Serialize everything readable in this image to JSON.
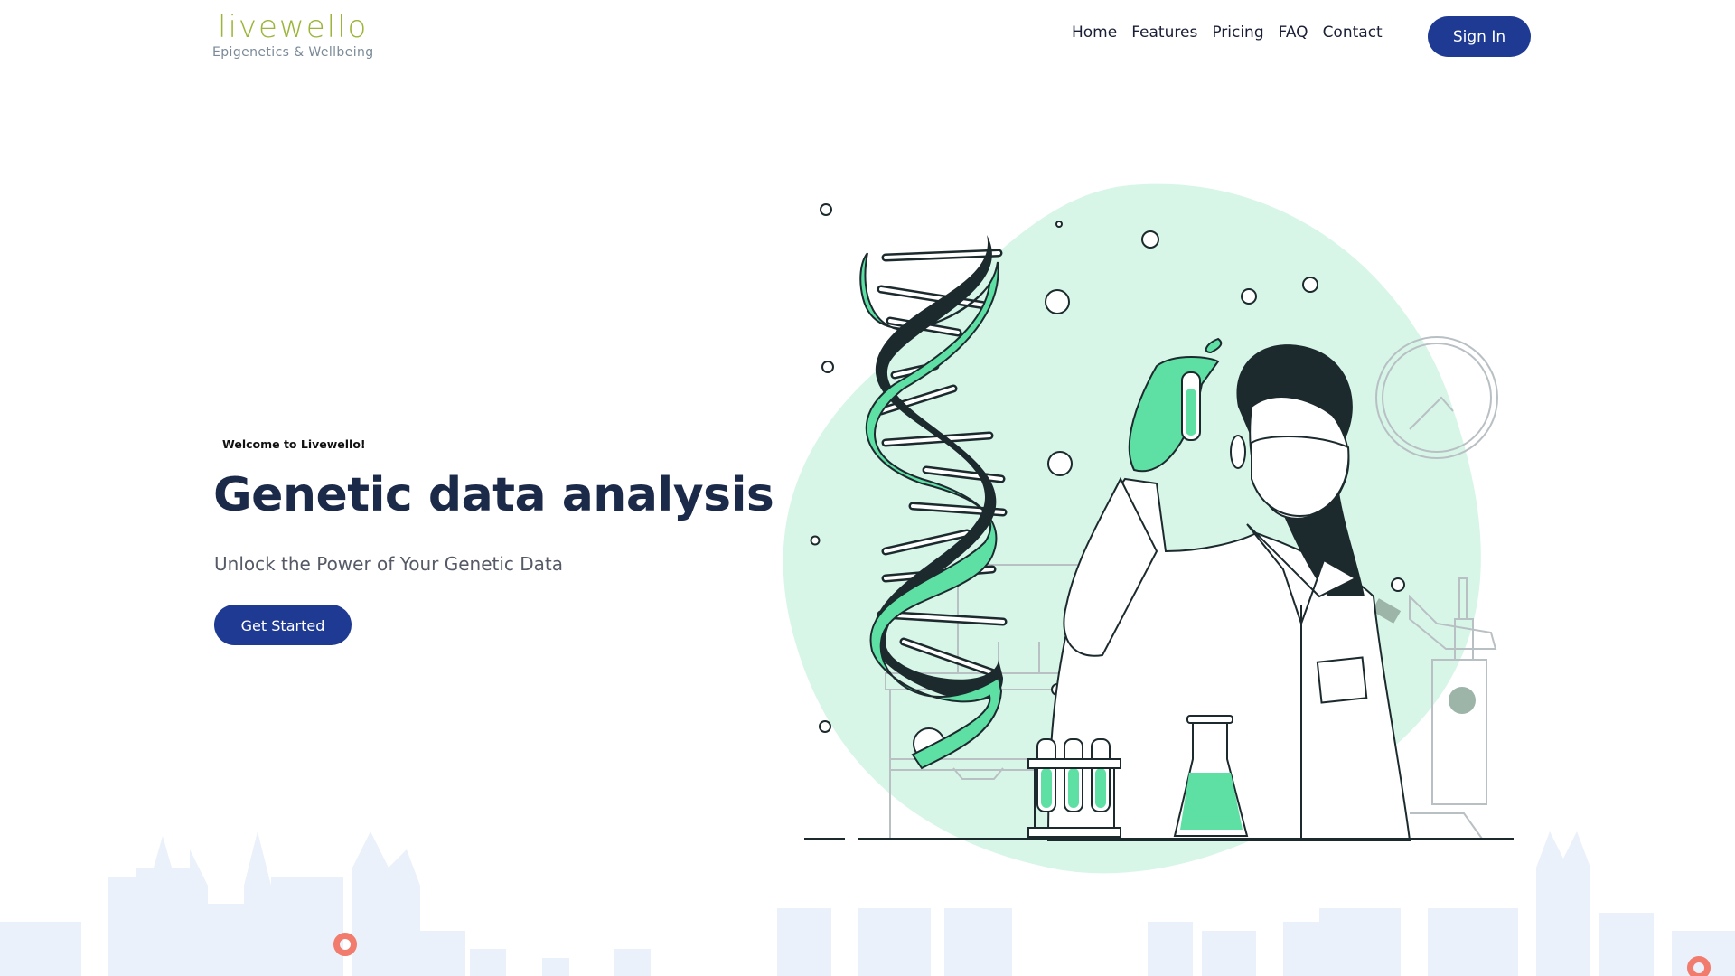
{
  "brand": {
    "name": "livewello",
    "tagline": "Epigenetics & Wellbeing",
    "color": "#9bb53a"
  },
  "nav": {
    "items": [
      "Home",
      "Features",
      "Pricing",
      "FAQ",
      "Contact"
    ],
    "signin_label": "Sign In"
  },
  "hero": {
    "eyebrow": "Welcome to Livewello!",
    "title": "Genetic data analysis",
    "subtitle": "Unlock the Power of Your Genetic Data",
    "cta_label": "Get Started"
  },
  "colors": {
    "primary": "#1f3a93",
    "heading": "#1c2a4a",
    "mint": "#5ee0a5",
    "mint_bg": "#d7f6e8",
    "skyline": "#eaf1fa",
    "accent_ring": "#f17b6c"
  },
  "icons": {
    "illustration": "scientist-with-dna-illustration",
    "decor": "decorative-ring-icon"
  }
}
